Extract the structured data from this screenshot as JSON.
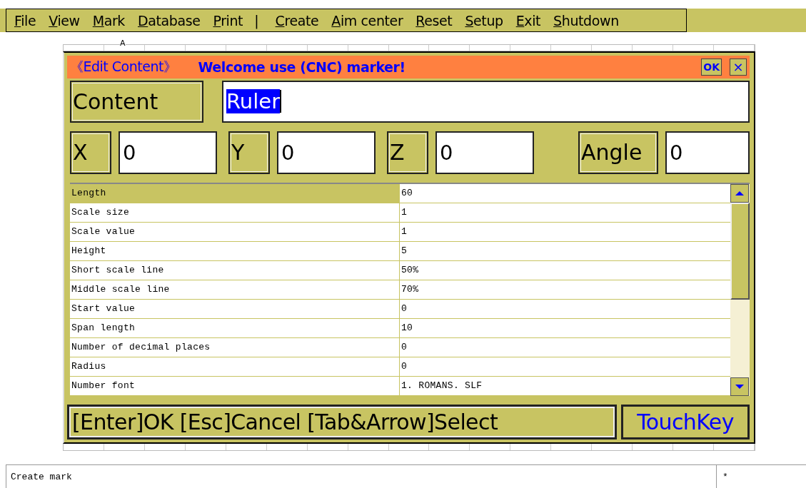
{
  "menu": [
    {
      "label": "File",
      "kind": "item"
    },
    {
      "label": "View",
      "kind": "item"
    },
    {
      "label": "Mark",
      "kind": "item"
    },
    {
      "label": "Database",
      "kind": "item"
    },
    {
      "label": "Print",
      "kind": "item"
    },
    {
      "label": "|",
      "kind": "separator"
    },
    {
      "label": "Create",
      "kind": "item"
    },
    {
      "label": "Aim center",
      "kind": "item"
    },
    {
      "label": "Reset",
      "kind": "item"
    },
    {
      "label": "Setup",
      "kind": "item"
    },
    {
      "label": "Exit",
      "kind": "item"
    },
    {
      "label": "Shutdown",
      "kind": "item"
    }
  ],
  "canvas_mark": "A",
  "dialog": {
    "title": "《Edit Content》",
    "welcome": "Welcome use  (CNC) marker!",
    "ok": "OK",
    "close": "×",
    "content": {
      "label": "Content",
      "value": "Ruler",
      "selected": true
    },
    "coords": [
      {
        "label": "X",
        "value": "0"
      },
      {
        "label": "Y",
        "value": "0"
      },
      {
        "label": "Z",
        "value": "0"
      },
      {
        "label": "Angle",
        "value": "0"
      }
    ],
    "properties": [
      {
        "name": "Length",
        "value": "60",
        "selected": true
      },
      {
        "name": "Scale size",
        "value": "1",
        "selected": false
      },
      {
        "name": "Scale value",
        "value": "1",
        "selected": false
      },
      {
        "name": "Height",
        "value": "5",
        "selected": false
      },
      {
        "name": "Short scale line",
        "value": "50%",
        "selected": false
      },
      {
        "name": "Middle scale line",
        "value": "70%",
        "selected": false
      },
      {
        "name": "Start value",
        "value": "0",
        "selected": false
      },
      {
        "name": "Span length",
        "value": "10",
        "selected": false
      },
      {
        "name": "Number of decimal places",
        "value": "0",
        "selected": false
      },
      {
        "name": "Radius",
        "value": "0",
        "selected": false
      },
      {
        "name": "Number font",
        "value": "1. ROMANS. SLF",
        "selected": false
      }
    ],
    "hint": "[Enter]OK [Esc]Cancel [Tab&Arrow]Select",
    "touchkey": "TouchKey"
  },
  "status_bar": {
    "message": "Create mark",
    "indicator": "*"
  }
}
